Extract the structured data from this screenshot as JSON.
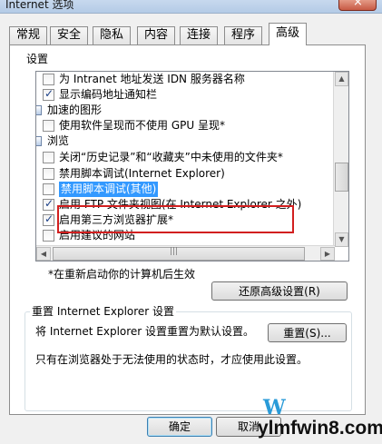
{
  "window": {
    "title": "Internet 选项"
  },
  "tabs": [
    {
      "label": "常规"
    },
    {
      "label": "安全"
    },
    {
      "label": "隐私"
    },
    {
      "label": "内容"
    },
    {
      "label": "连接"
    },
    {
      "label": "程序"
    },
    {
      "label": "高级"
    }
  ],
  "settings": {
    "group_label": "设置",
    "items": [
      {
        "label": "为 Intranet 地址发送 IDN 服务器名称",
        "checked": false
      },
      {
        "label": "显示编码地址通知栏",
        "checked": true
      },
      {
        "label": "加速的图形",
        "category": true
      },
      {
        "label": "使用软件呈现而不使用 GPU 呈现*",
        "checked": false
      },
      {
        "label": "浏览",
        "category": true
      },
      {
        "label": "关闭“历史记录”和“收藏夹”中未使用的文件夹*",
        "checked": false
      },
      {
        "label": "禁用脚本调试(Internet Explorer)",
        "checked": false
      },
      {
        "label": "禁用脚本调试(其他)",
        "checked": false,
        "selected": true
      },
      {
        "label": "启用 FTP 文件夹视图(在 Internet Explorer 之外)",
        "checked": true
      },
      {
        "label": "启用第三方浏览器扩展*",
        "checked": true
      },
      {
        "label": "启用建议的网站",
        "checked": false
      }
    ],
    "restart_note": "*在重新启动你的计算机后生效",
    "restore_button": "还原高级设置(R)"
  },
  "reset": {
    "legend": "重置 Internet Explorer 设置",
    "description": "将 Internet Explorer 设置重置为默认设置。",
    "button": "重置(S)...",
    "note": "只有在浏览器处于无法使用的状态时，才应使用此设置。"
  },
  "footer": {
    "ok": "确定",
    "cancel": "取消"
  },
  "watermark": {
    "logo": "W",
    "text": "ylmfwin8.com"
  },
  "colors": {
    "highlight": "#3399ff",
    "annotation_box": "#d21f1f"
  }
}
